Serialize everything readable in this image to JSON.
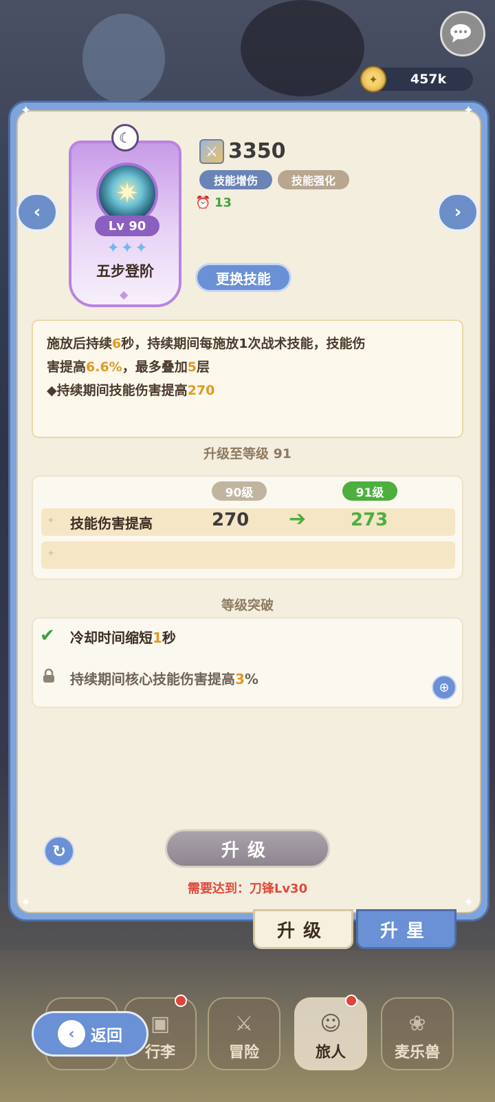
{
  "header": {
    "coins": "457k"
  },
  "skill": {
    "level_label": "Lv 90",
    "name": "五步登阶",
    "power": "3350",
    "tags": [
      "技能增伤",
      "技能强化"
    ],
    "cooldown": "13",
    "swap_label": "更换技能",
    "stars": 3
  },
  "description": {
    "line1_a": "施放后持续",
    "line1_b": "6",
    "line1_c": "秒，持续期间每施放1次战术技能，技能伤",
    "line2_a": "害提高",
    "line2_b": "6.6%",
    "line2_c": "，最多叠加",
    "line2_d": "5",
    "line2_e": "层",
    "line3_a": "◆持续期间技能伤害提高",
    "line3_b": "270"
  },
  "upgrade": {
    "title": "升级至等级 91",
    "from_level": "90级",
    "to_level": "91级",
    "stat_name": "技能伤害提高",
    "from_value": "270",
    "to_value": "273"
  },
  "breakthrough": {
    "title": "等级突破",
    "item1_a": "冷却时间缩短",
    "item1_b": "1",
    "item1_c": "秒",
    "item2_a": "持续期间核心技能伤害提高",
    "item2_b": "3",
    "item2_c": "%"
  },
  "actions": {
    "upgrade_button": "升级",
    "requirement": "需要达到：刀锋Lv30"
  },
  "tabs": {
    "upgrade": "升级",
    "star_up": "升星"
  },
  "bottom_nav": {
    "back": "返回",
    "items": [
      "行李",
      "冒险",
      "旅人",
      "麦乐兽"
    ]
  }
}
